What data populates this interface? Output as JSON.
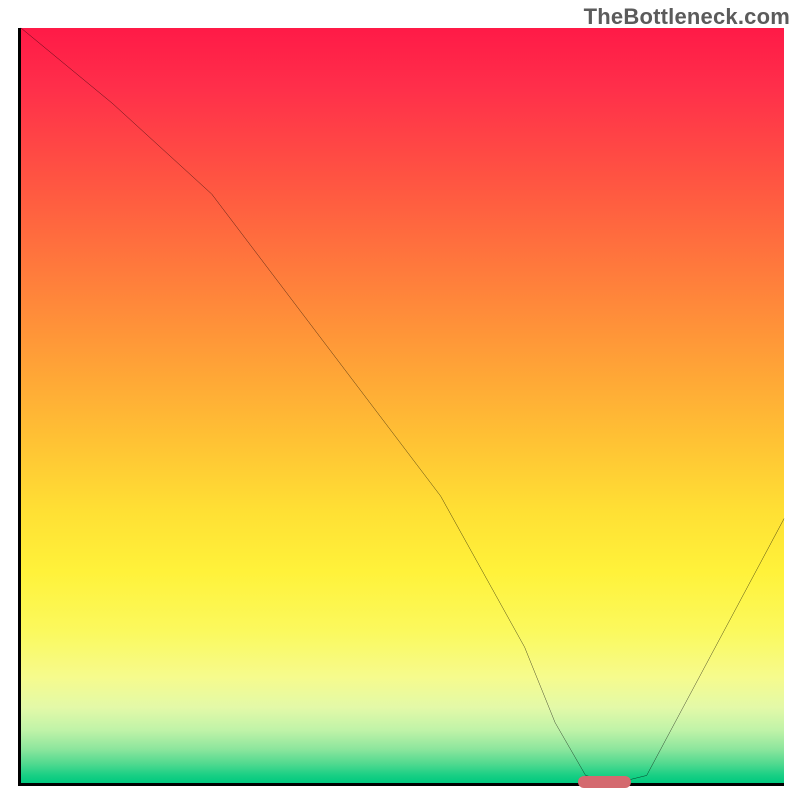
{
  "watermark": "TheBottleneck.com",
  "chart_data": {
    "type": "line",
    "title": "",
    "xlabel": "",
    "ylabel": "",
    "xlim": [
      0,
      100
    ],
    "ylim": [
      0,
      100
    ],
    "grid": false,
    "legend": false,
    "curve": {
      "name": "bottleneck-curve",
      "x": [
        0,
        12,
        25,
        40,
        55,
        66,
        70,
        74,
        78,
        82,
        100
      ],
      "y": [
        100,
        90,
        78,
        58,
        38,
        18,
        8,
        1,
        0,
        1,
        35
      ]
    },
    "marker": {
      "name": "optimal-range",
      "x_start": 73,
      "x_end": 80,
      "y": 0,
      "color": "#d46a6f"
    },
    "gradient_stops": [
      {
        "pos": 0,
        "color": "#ff1a47"
      },
      {
        "pos": 20,
        "color": "#ff5442"
      },
      {
        "pos": 44,
        "color": "#ffa037"
      },
      {
        "pos": 72,
        "color": "#fff23a"
      },
      {
        "pos": 90,
        "color": "#e3f9a8"
      },
      {
        "pos": 100,
        "color": "#00c97f"
      }
    ]
  }
}
